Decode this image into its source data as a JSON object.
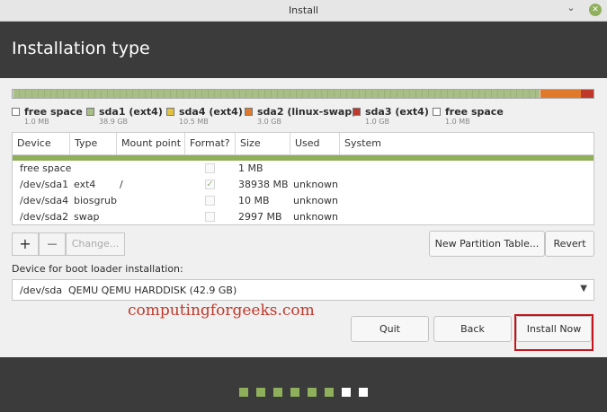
{
  "window": {
    "title": "Install"
  },
  "header": {
    "title": "Installation type"
  },
  "partition_bar": [
    {
      "kind": "free",
      "fraction": 0.002
    },
    {
      "kind": "ext4",
      "fraction": 0.905
    },
    {
      "kind": "free",
      "fraction": 0.002
    },
    {
      "kind": "swap",
      "fraction": 0.07
    },
    {
      "kind": "ext4b",
      "fraction": 0.021
    }
  ],
  "legend": [
    {
      "name": "free space",
      "size": "1.0 MB",
      "color": "#ffffff"
    },
    {
      "name": "sda1 (ext4)",
      "size": "38.9 GB",
      "color": "#a7bf86"
    },
    {
      "name": "sda4 (ext4)",
      "size": "10.5 MB",
      "color": "#e2c340"
    },
    {
      "name": "sda2 (linux-swap)",
      "size": "3.0 GB",
      "color": "#e07a2a"
    },
    {
      "name": "sda3 (ext4)",
      "size": "1.0 GB",
      "color": "#c0382b"
    },
    {
      "name": "free space",
      "size": "1.0 MB",
      "color": "#ffffff"
    }
  ],
  "table": {
    "columns": [
      "Device",
      "Type",
      "Mount point",
      "Format?",
      "Size",
      "Used",
      "System"
    ],
    "rows": [
      {
        "device": "free space",
        "type": "",
        "mount": "",
        "format": false,
        "size": "1 MB",
        "used": "",
        "system": ""
      },
      {
        "device": "/dev/sda1",
        "type": "ext4",
        "mount": "/",
        "format": true,
        "size": "38938 MB",
        "used": "unknown",
        "system": ""
      },
      {
        "device": "/dev/sda4",
        "type": "biosgrub",
        "mount": "",
        "format": false,
        "size": "10 MB",
        "used": "unknown",
        "system": ""
      },
      {
        "device": "/dev/sda2",
        "type": "swap",
        "mount": "",
        "format": false,
        "size": "2997 MB",
        "used": "unknown",
        "system": ""
      }
    ]
  },
  "partition_toolbar": {
    "add": "+",
    "remove": "—",
    "change": "Change...",
    "new_table": "New Partition Table...",
    "revert": "Revert"
  },
  "bootloader": {
    "label": "Device for boot loader installation:",
    "device": "/dev/sda",
    "description": "QEMU QEMU HARDDISK (42.9 GB)"
  },
  "watermark": "computingforgeeks.com",
  "actions": {
    "quit": "Quit",
    "back": "Back",
    "install": "Install Now"
  },
  "progress": {
    "completed_steps": 6,
    "total_steps": 8
  }
}
